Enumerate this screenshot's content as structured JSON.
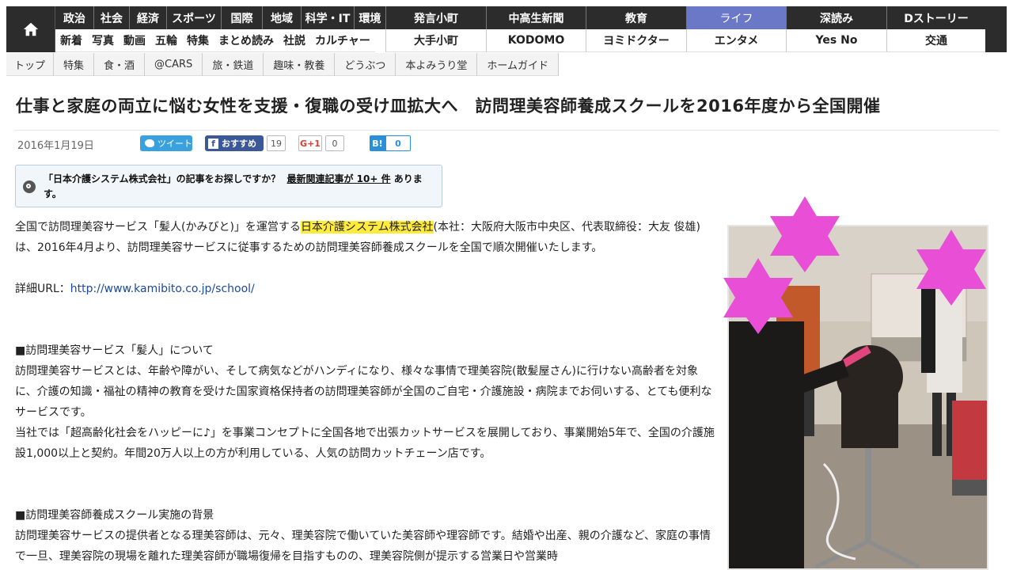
{
  "nav": {
    "home_icon": "home-icon",
    "row1_categories": [
      "政治",
      "社会",
      "経済",
      "スポーツ",
      "国際",
      "地域",
      "科学・IT",
      "環境"
    ],
    "row2_categories": [
      "新着",
      "写真",
      "動画",
      "五輪",
      "特集",
      "まとめ読み",
      "社説",
      "カルチャー"
    ],
    "row1_sections": [
      "発言小町",
      "中高生新聞",
      "教育",
      "ライフ",
      "深読み",
      "Dストーリー"
    ],
    "row2_sections": [
      "大手小町",
      "KODOMO",
      "ヨミドクター",
      "エンタメ",
      "Yes No",
      "交通"
    ],
    "active_section": "ライフ",
    "active_color": "#6b78c8"
  },
  "subnav": {
    "items": [
      "トップ",
      "特集",
      "食・酒",
      "@CARS",
      "旅・鉄道",
      "趣味・教養",
      "どうぶつ",
      "本よみうり堂",
      "ホームガイド"
    ]
  },
  "article": {
    "title": "仕事と家庭の両立に悩む女性を支援・復職の受け皿拡大へ　訪問理美容師養成スクールを2016年度から全国開催",
    "date": "2016年1月19日",
    "share": {
      "tweet_label": "ツイート",
      "fb_label": "おすすめ",
      "fb_count": "19",
      "gplus_label": "G+1",
      "gplus_count": "0",
      "hatena_label": "B!",
      "hatena_count": "0"
    },
    "related": {
      "text_before": "「日本介護システム株式会社」の記事をお探しですか？",
      "link_text": "最新関連記事が 10+ 件",
      "text_after": "あります。"
    },
    "p1_before": "全国で訪問理美容サービス「髪人(かみびと)」を運営する",
    "p1_company": "日本介護システム株式会社",
    "p1_after": "(本社：大阪府大阪市中央区、代表取締役：大友 俊雄)は、2016年4月より、訪問理美容サービスに従事するための訪問理美容師養成スクールを全国で順次開催いたします。",
    "url_label": "詳細URL：",
    "url": "http://www.kamibito.co.jp/school/",
    "section1_heading": "■訪問理美容サービス「髪人」について",
    "section1_p1": "訪問理美容サービスとは、年齢や障がい、そして病気などがハンディになり、様々な事情で理美容院(散髪屋さん)に行けない高齢者を対象に、介護の知識・福祉の精神の教育を受けた国家資格保持者の訪問理美容師が全国のご自宅・介護施設・病院までお伺いする、とても便利なサービスです。",
    "section1_p2": "当社では「超高齢化社会をハッピーに♪」を事業コンセプトに全国各地で出張カットサービスを展開しており、事業開始5年で、全国の介護施設1,000以上と契約。年間20万人以上の方が利用している、人気の訪問カットチェーン店です。",
    "section2_heading": "■訪問理美容師養成スクール実施の背景",
    "section2_p1": "訪問理美容サービスの提供者となる理美容師は、元々、理美容院で働いていた美容師や理容師です。結婚や出産、親の介護など、家庭の事情で一旦、理美容院の現場を離れた理美容師が職場復帰を目指すものの、理美容院側が提示する営業日や営業時"
  },
  "photo": {
    "description_icon": "salon-photo",
    "star_color": "#e84fd6"
  }
}
